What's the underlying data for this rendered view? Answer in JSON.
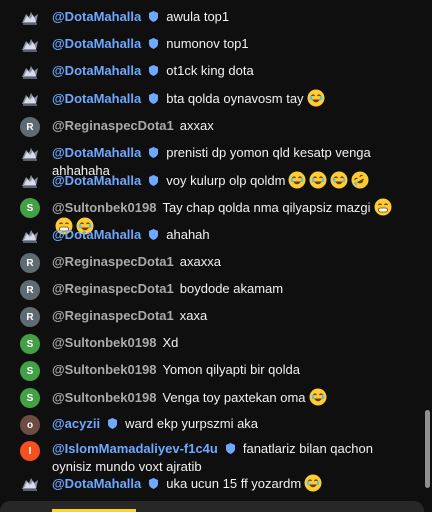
{
  "messages": [
    {
      "author": "@DotaMahalla",
      "avatar": "dota",
      "badge": true,
      "text": "awula top1",
      "emojis": []
    },
    {
      "author": "@DotaMahalla",
      "avatar": "dota",
      "badge": true,
      "text": "numonov top1",
      "emojis": []
    },
    {
      "author": "@DotaMahalla",
      "avatar": "dota",
      "badge": true,
      "text": "ot1ck king dota",
      "emojis": []
    },
    {
      "author": "@DotaMahalla",
      "avatar": "dota",
      "badge": true,
      "text": "bta qolda oynavosm tay",
      "emojis": [
        "joy"
      ]
    },
    {
      "author": "@ReginaspecDota1",
      "avatar": "R",
      "badge": false,
      "text": "axxax",
      "emojis": []
    },
    {
      "author": "@DotaMahalla",
      "avatar": "dota",
      "badge": true,
      "text": "prenisti dp yomon qld kesatp venga ahhahaha",
      "emojis": []
    },
    {
      "author": "@DotaMahalla",
      "avatar": "dota",
      "badge": true,
      "text": "voy kulurp olp qoldm",
      "emojis": [
        "joy",
        "joy",
        "joy",
        "rofl"
      ]
    },
    {
      "author": "@Sultonbek0198",
      "avatar": "S",
      "badge": false,
      "text": "Tay chap qolda nma qilyapsiz mazgi",
      "emojis": [
        "grin",
        "grin",
        "joy"
      ]
    },
    {
      "author": "@DotaMahalla",
      "avatar": "dota",
      "badge": true,
      "text": "ahahah",
      "emojis": []
    },
    {
      "author": "@ReginaspecDota1",
      "avatar": "R",
      "badge": false,
      "text": "axaxxa",
      "emojis": []
    },
    {
      "author": "@ReginaspecDota1",
      "avatar": "R",
      "badge": false,
      "text": "boydode akamam",
      "emojis": []
    },
    {
      "author": "@ReginaspecDota1",
      "avatar": "R",
      "badge": false,
      "text": "xaxa",
      "emojis": []
    },
    {
      "author": "@Sultonbek0198",
      "avatar": "S",
      "badge": false,
      "text": "Xd",
      "emojis": []
    },
    {
      "author": "@Sultonbek0198",
      "avatar": "S",
      "badge": false,
      "text": "Yomon qilyapti bir qolda",
      "emojis": []
    },
    {
      "author": "@Sultonbek0198",
      "avatar": "S",
      "badge": false,
      "text": "Venga toy paxtekan oma",
      "emojis": [
        "joy"
      ]
    },
    {
      "author": "@acyzii",
      "avatar": "o",
      "badge": true,
      "text": "ward ekp yurpszmi aka",
      "emojis": []
    },
    {
      "author": "@IslomMamadaliyev-f1c4u",
      "avatar": "I",
      "badge": true,
      "text": "fanatlariz bilan qachon oynisiz mundo voxt ajratib",
      "emojis": []
    },
    {
      "author": "@DotaMahalla",
      "avatar": "dota",
      "badge": true,
      "text": "uka ucun 15 ff yozardm",
      "emojis": [
        "joy"
      ]
    }
  ],
  "colors": {
    "background": "#0f0f0f",
    "member_name": "#6ea8ff",
    "viewer_name": "#aaaaaa",
    "text": "#f1f1f1"
  }
}
